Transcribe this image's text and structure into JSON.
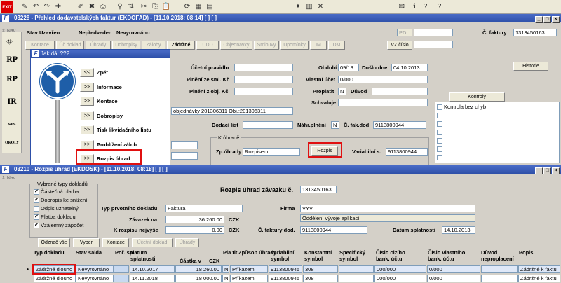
{
  "toolbar": {
    "exit_label": "EXIT",
    "icons": [
      "save-icon",
      "undo-icon",
      "redo-icon",
      "new-icon",
      "edit-icon",
      "delete-icon",
      "print-icon",
      "filter-icon",
      "sort-icon",
      "cut-icon",
      "copy-icon",
      "paste-icon",
      "refresh-icon",
      "table-icon",
      "calendar-icon",
      "star-icon",
      "calculator-icon",
      "excel-icon",
      "mail-icon",
      "info-icon",
      "help-icon",
      "help-cursor-icon"
    ]
  },
  "window1": {
    "nav_label": "Nav",
    "title": "03228 - Přehled dodavatelských faktur (EKDOFAD) - [11.10.2018; 08:14] [ ] [ ]",
    "stav_label": "Stav",
    "stav_value": "Uzavřen",
    "stav2": "Nepředveden",
    "stav3": "Nevyrovnáno",
    "pd_placeholder": "PD",
    "c_faktury_label": "Č. faktury",
    "c_faktury_value": "1313450163",
    "tabs": [
      "Kontace",
      "Úč.doklad",
      "Úhrady",
      "Dobropisy",
      "Zálohy",
      "Zádržné",
      "UDD",
      "Objednávky",
      "Smlouvy",
      "Upomínky",
      "IM",
      "DM"
    ],
    "vz_cislo": "VZ číslo",
    "ucetni_pravidlo": "Účetní pravidlo",
    "plneni_ze_sml": "Plnění ze sml. Kč",
    "plneni_z_obj": "Plnění z obj. Kč",
    "obdobi_label": "Období",
    "obdobi_value": "09/13",
    "doslo_dne_label": "Došlo dne",
    "doslo_dne_value": "04.10.2013",
    "vlastni_ucet_label": "Vlastní účet",
    "vlastni_ucet_value": "0/000",
    "proplatit_label": "Proplatit",
    "proplatit_value": "N",
    "duvod_label": "Důvod",
    "schvaluje_label": "Schvaluje",
    "objednavky_text": "objednávky 201306311 Obj.:201306311",
    "historie": "Historie",
    "kontroly": "Kontroly",
    "kontrola_bez_chyb": "Kontrola bez chyb",
    "dodaci_list": "Dodací list",
    "nahr_plneni_label": "Náhr.plnění",
    "nahr_plneni_value": "N",
    "c_fak_dod_label": "Č. fak.dod",
    "c_fak_dod_value": "9113800944",
    "k_uhrade_title": "K úhradě",
    "zp_uhrady_label": "Zp.úhrady",
    "zp_uhrady_value": "Rozpisem",
    "rozpis_button": "Rozpis",
    "variabilni_label": "Variabilní s.",
    "variabilni_value": "9113800944"
  },
  "popup": {
    "title": "Jak dál ???",
    "items": [
      {
        "btn": "<<",
        "label": "Zpět"
      },
      {
        "btn": ">>",
        "label": "Informace"
      },
      {
        "btn": ">>",
        "label": "Kontace"
      },
      {
        "btn": ">>",
        "label": "Dobropisy"
      },
      {
        "btn": ">>",
        "label": "Tisk likvidačního listu"
      },
      {
        "btn": ">>",
        "label": "Prohlížení záloh"
      },
      {
        "btn": ">>",
        "label": "Rozpis úhrad"
      }
    ]
  },
  "side_nav": {
    "items": [
      "RP",
      "RP",
      "IR",
      "SPS",
      "OKOLY"
    ]
  },
  "window2": {
    "nav_label": "Nav",
    "title": "03210 - Rozpis úhrad (EKDOSK) - [11.10.2018; 08:18] [ ] [ ]",
    "vybrane_typy_title": "Vybrané typy dokladů",
    "checkboxes": [
      {
        "label": "Částečná platba",
        "checked": true
      },
      {
        "label": "Dobropis ke snížení",
        "checked": true
      },
      {
        "label": "Odpis uznatelný",
        "checked": false
      },
      {
        "label": "Platba dokladu",
        "checked": true
      },
      {
        "label": "Vzájemný zápočet",
        "checked": true
      }
    ],
    "heading": "Rozpis úhrad závazku č.",
    "heading_value": "1313450163",
    "typ_prvotniho_label": "Typ prvotního dokladu",
    "typ_prvotniho_value": "Faktura",
    "firma_label": "Firma",
    "firma_value": "VYV",
    "firma_sub": "Oddělení vývoje aplikací",
    "zavazek_label": "Závazek na",
    "zavazek_value": "36 260.00",
    "zavazek_currency": "CZK",
    "k_rozpisu_label": "K rozpisu nejvýše",
    "k_rozpisu_value": "0.00",
    "k_rozpisu_currency": "CZK",
    "c_faktury_dod_label": "Č. faktury dod.",
    "c_faktury_dod_value": "9113800944",
    "datum_splatnosti_label": "Datum splatnosti",
    "datum_splatnosti_value": "14.10.2013",
    "buttons": [
      {
        "label": "Odznač vše",
        "disabled": false
      },
      {
        "label": "Vyber",
        "disabled": false
      },
      {
        "label": "Kontace",
        "disabled": false
      },
      {
        "label": "Účetní doklad",
        "disabled": true
      },
      {
        "label": "Úhrady",
        "disabled": true
      }
    ],
    "columns": {
      "typ": "Typ dokladu",
      "stav": "Stav salda",
      "por": "Poř. spl.",
      "datum": "Datum splatnosti",
      "castka": "Částka v",
      "czk": "CZK",
      "pl": "Pla tit",
      "zpusob": "Způsob úhrady",
      "variabilni": "Variabilní symbol",
      "konstantni": "Konstantní symbol",
      "specificky": "Specifický symbol",
      "cislo_ciziho": "Číslo cizího bank. účtu",
      "cislo_vlastniho": "Číslo vlastního bank. účtu",
      "duvod": "Důvod neproplacení",
      "popis": "Popis"
    },
    "rows": [
      {
        "typ": "Zádržné dlouho",
        "stav": "Nevyrovnáno",
        "por": "",
        "datum": "14.10.2017",
        "castka": "18 260.00",
        "pl": "N",
        "zpusob": "Příkazem",
        "variabilni": "9113800945",
        "konstantni": "308",
        "specificky": "",
        "cislo_ciziho": "000/000",
        "cislo_vlastniho": "0/000",
        "duvod": "",
        "popis": "Zádržné k faktu"
      },
      {
        "typ": "Zádržné dlouho",
        "stav": "Nevyrovnáno",
        "por": "",
        "datum": "14.11.2018",
        "castka": "18 000.00",
        "pl": "N",
        "zpusob": "Příkazem",
        "variabilni": "9113800945",
        "konstantni": "308",
        "specificky": "",
        "cislo_ciziho": "000/000",
        "cislo_vlastniho": "0/000",
        "duvod": "",
        "popis": "Zádržné k faktu"
      }
    ]
  }
}
